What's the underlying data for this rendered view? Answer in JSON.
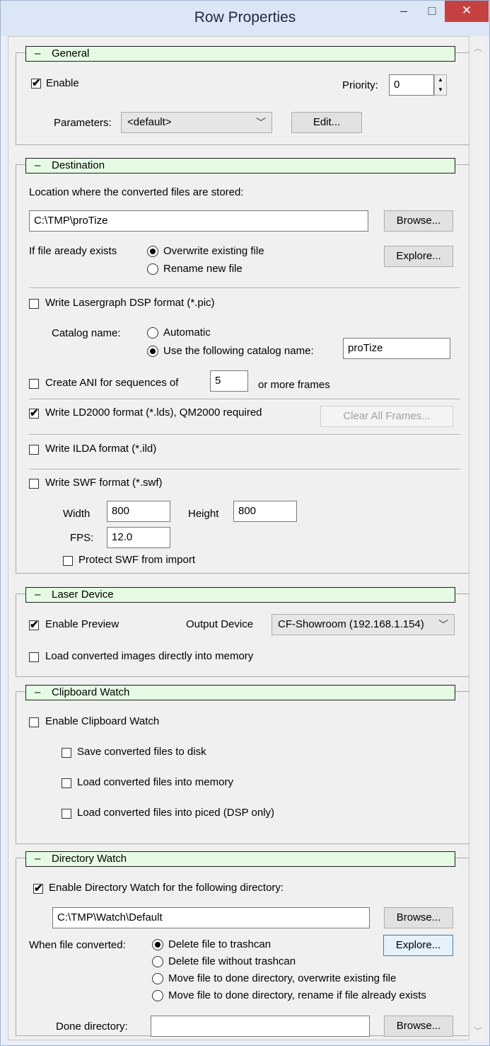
{
  "window": {
    "title": "Row Properties",
    "minimize": "–",
    "maximize": "□",
    "close": "✕"
  },
  "general": {
    "header": "General",
    "enable_label": "Enable",
    "enable_checked": true,
    "priority_label": "Priority:",
    "priority_value": "0",
    "parameters_label": "Parameters:",
    "parameters_value": "<default>",
    "edit_button": "Edit..."
  },
  "destination": {
    "header": "Destination",
    "location_label": "Location where the converted files are stored:",
    "path_value": "C:\\TMP\\proTize",
    "browse_button": "Browse...",
    "exists_label": "If file aready exists",
    "overwrite_label": "Overwrite existing file",
    "rename_label": "Rename new file",
    "explore_button": "Explore...",
    "lasergraph_label": "Write Lasergraph DSP format (*.pic)",
    "catalog_label": "Catalog name:",
    "automatic_label": "Automatic",
    "use_catalog_label": "Use the following catalog name:",
    "catalog_value": "proTize",
    "ani_label": "Create ANI for sequences of",
    "ani_value": "5",
    "ani_suffix": "or more frames",
    "ld2000_label": "Write LD2000 format (*.lds), QM2000 required",
    "clear_frames_button": "Clear All Frames...",
    "ilda_label": "Write ILDA format (*.ild)",
    "swf_label": "Write SWF format (*.swf)",
    "width_label": "Width",
    "width_value": "800",
    "height_label": "Height",
    "height_value": "800",
    "fps_label": "FPS:",
    "fps_value": "12.0",
    "protect_label": "Protect SWF from import"
  },
  "laser": {
    "header": "Laser Device",
    "preview_label": "Enable Preview",
    "output_label": "Output Device",
    "output_value": "CF-Showroom (192.168.1.154)",
    "load_label": "Load converted images directly into memory"
  },
  "clipboard": {
    "header": "Clipboard Watch",
    "enable_label": "Enable Clipboard Watch",
    "save_label": "Save converted files to disk",
    "memory_label": "Load converted files into memory",
    "piced_label": "Load converted files into piced (DSP only)"
  },
  "dirwatch": {
    "header": "Directory Watch",
    "enable_label": "Enable Directory Watch for the following directory:",
    "path_value": "C:\\TMP\\Watch\\Default",
    "browse_button": "Browse...",
    "converted_label": "When file converted:",
    "opt1": "Delete file to trashcan",
    "opt2": "Delete file without trashcan",
    "opt3": "Move file to done directory, overwrite existing file",
    "opt4": "Move file to done directory, rename if file already exists",
    "explore_button": "Explore...",
    "done_label": "Done directory:",
    "done_value": "",
    "browse2_button": "Browse..."
  }
}
